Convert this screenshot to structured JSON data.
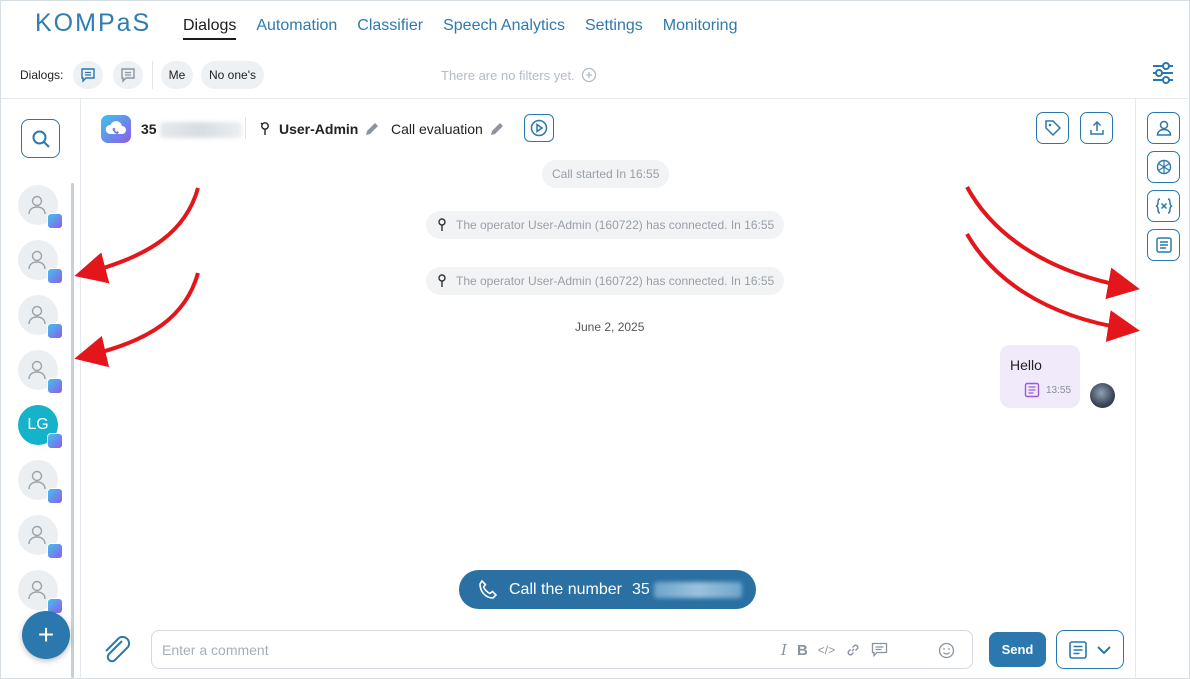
{
  "app": {
    "logo": "KOMPaS"
  },
  "nav": {
    "items": [
      "Dialogs",
      "Automation",
      "Classifier",
      "Speech Analytics",
      "Settings",
      "Monitoring"
    ],
    "active": "Dialogs"
  },
  "filters": {
    "label": "Dialogs:",
    "me": "Me",
    "no_ones": "No one's",
    "empty": "There are no filters yet."
  },
  "dialog_list": {
    "avatar_initials": "LG"
  },
  "chat_header": {
    "number_prefix": "35",
    "operator": "User-Admin",
    "evaluation": "Call evaluation"
  },
  "messages": {
    "call_started": "Call started In 16:55",
    "connected_1": "The operator User-Admin (160722) has connected. In 16:55",
    "connected_2": "The operator User-Admin (160722) has connected. In 16:55",
    "date": "June 2, 2025",
    "bubble_text": "Hello",
    "bubble_time": "13:55"
  },
  "call_button": {
    "label": "Call the number",
    "number_prefix": "35"
  },
  "composer": {
    "placeholder": "Enter a comment",
    "send": "Send"
  },
  "colors": {
    "accent": "#2a78ad",
    "bubble": "#f0eafb",
    "avatar_lg": "#14b3c9",
    "arrow": "#e3161b"
  }
}
